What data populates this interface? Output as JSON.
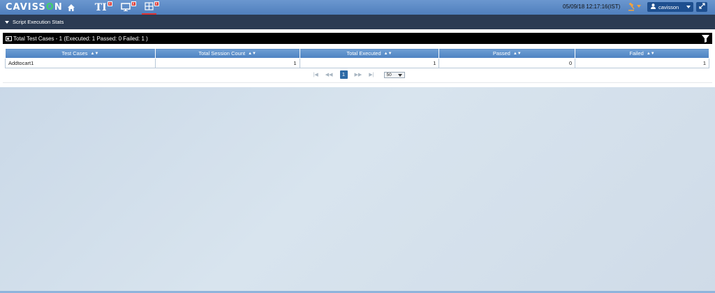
{
  "header": {
    "logo_text_a": "CAVISS",
    "logo_text_b": "O",
    "logo_text_c": "N",
    "tabs": [
      {
        "label": "TI",
        "close": "x"
      },
      {
        "label": "",
        "close": "x"
      },
      {
        "label": "",
        "close": "x"
      }
    ],
    "datetime": "05/09/18 12:17:16(IST)",
    "user": "cavisson"
  },
  "section": {
    "title": "Script Execution Stats"
  },
  "panel": {
    "title": "Total Test Cases - 1 (Executed: 1 Passed: 0 Failed: 1 )"
  },
  "table": {
    "columns": [
      "Test Cases",
      "Total Session Count",
      "Total Executed",
      "Passed",
      "Failed"
    ],
    "rows": [
      [
        "Addtocart1",
        "1",
        "1",
        "0",
        "1"
      ]
    ]
  },
  "pager": {
    "current_page": "1",
    "rows_per_page": "50"
  },
  "colors": {
    "topbar": "#5b8ac6",
    "section_bar": "#2b3b53",
    "table_header": "#5d90cb",
    "active_tab_underline": "#e03333",
    "tab_close": "#d9302c"
  }
}
